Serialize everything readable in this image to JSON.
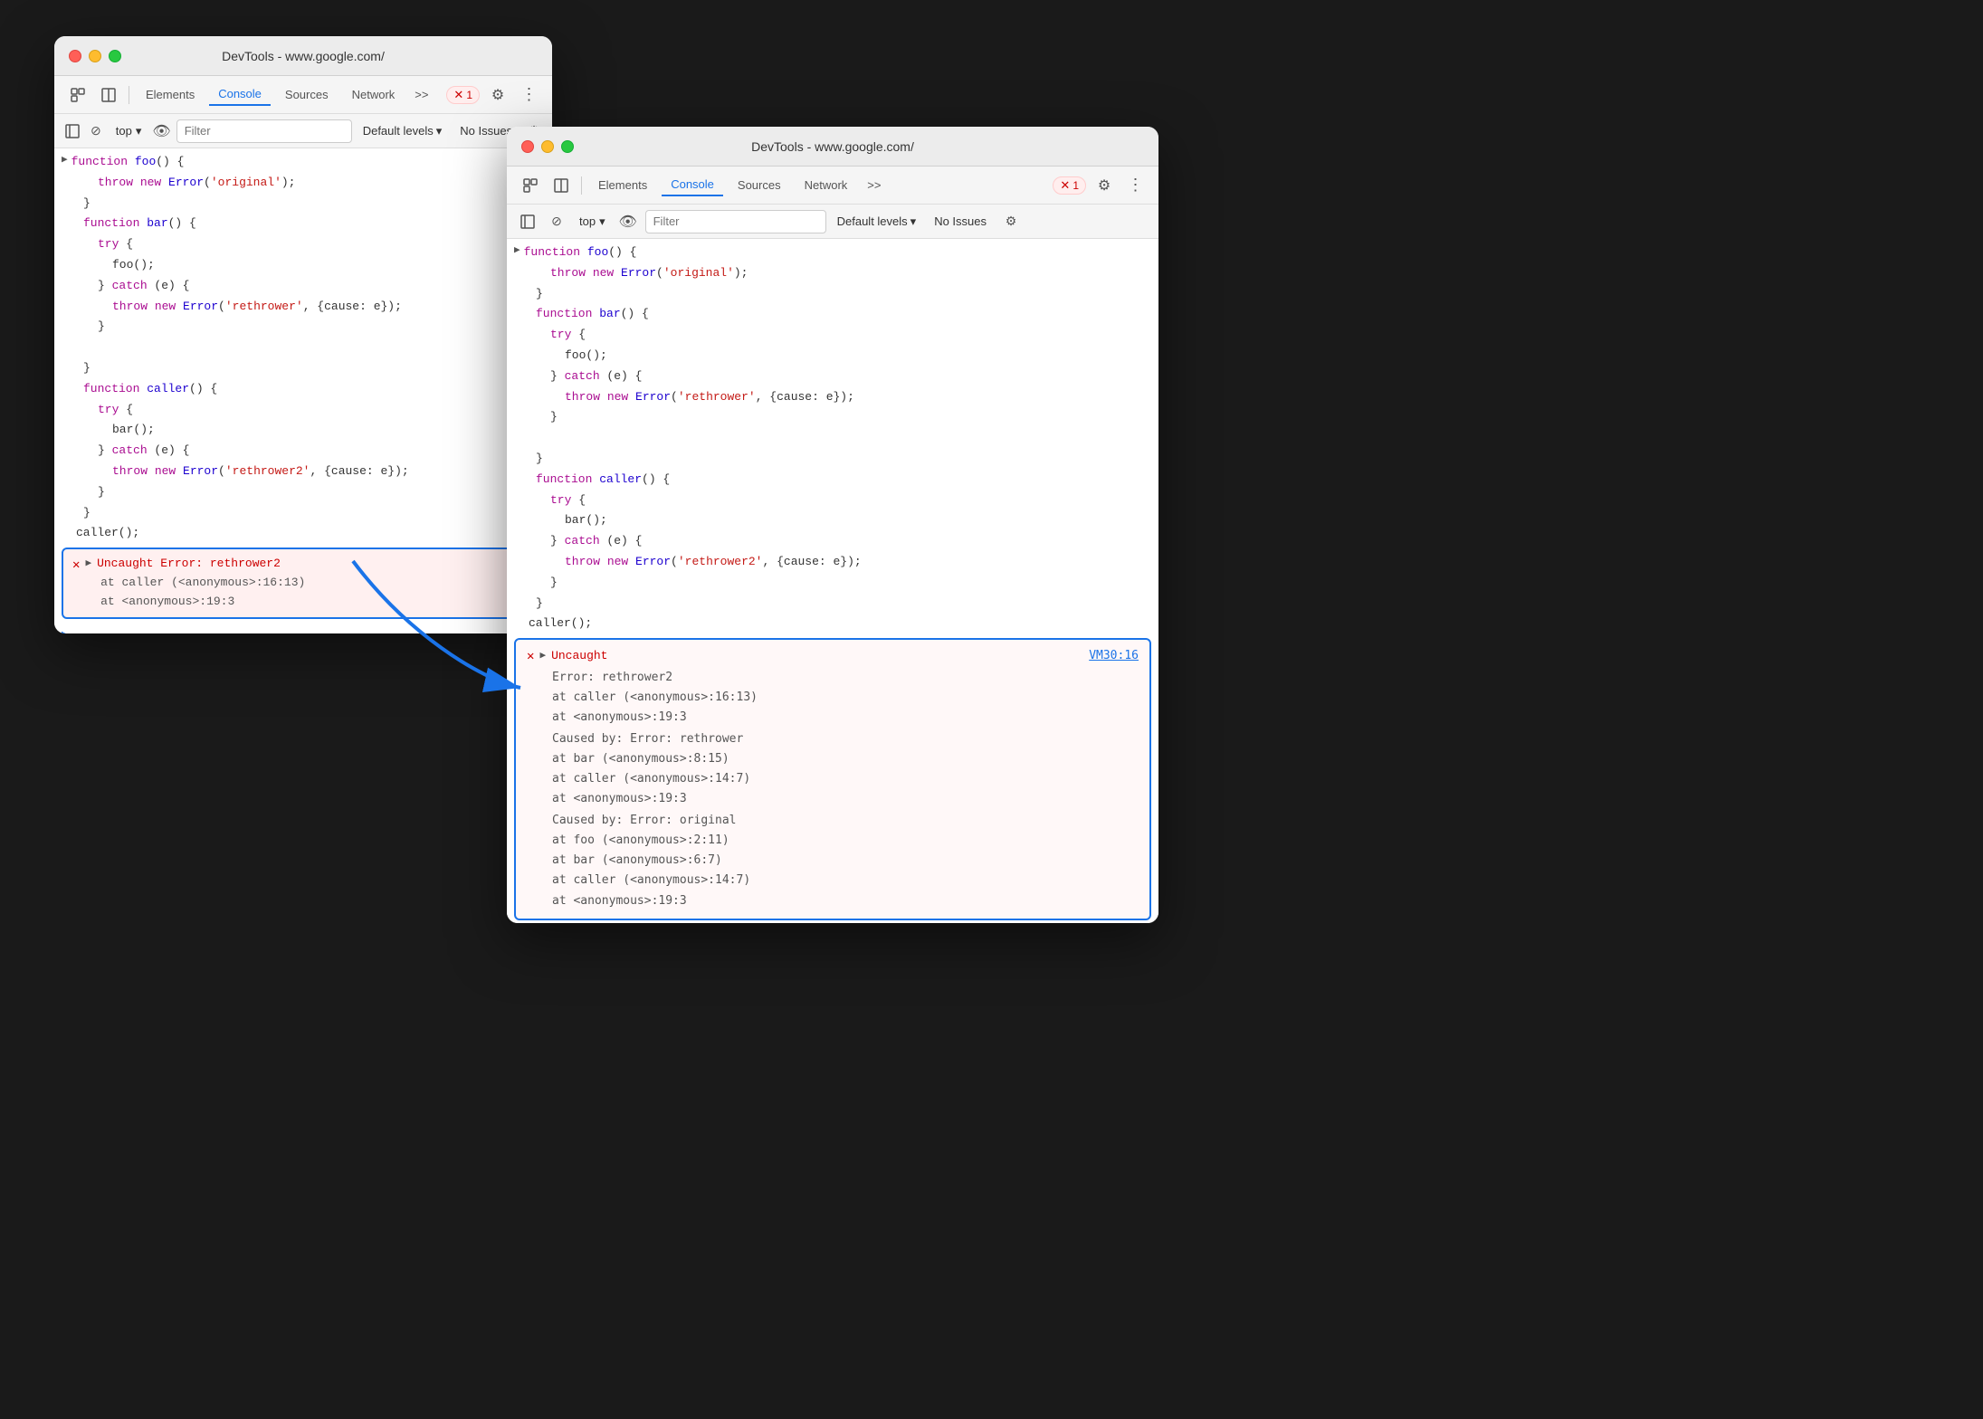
{
  "window1": {
    "title": "DevTools - www.google.com/",
    "tabs": [
      "Elements",
      "Console",
      "Sources",
      "Network",
      ">>"
    ],
    "active_tab": "Console",
    "console_toolbar": {
      "top_label": "top",
      "filter_placeholder": "Filter",
      "levels_label": "Default levels",
      "no_issues": "No Issues"
    },
    "code": [
      {
        "indent": 2,
        "content": "function foo() {"
      },
      {
        "indent": 4,
        "content": "throw new Error('original');"
      },
      {
        "indent": 2,
        "content": "}"
      },
      {
        "indent": 2,
        "content": "function bar() {"
      },
      {
        "indent": 4,
        "content": "try {"
      },
      {
        "indent": 6,
        "content": "foo();"
      },
      {
        "indent": 4,
        "content": "} catch (e) {"
      },
      {
        "indent": 6,
        "content": "throw new Error('rethrower', {cause: e});"
      },
      {
        "indent": 4,
        "content": "}"
      },
      {
        "indent": 2,
        "content": ""
      },
      {
        "indent": 2,
        "content": "}"
      },
      {
        "indent": 2,
        "content": "function caller() {"
      },
      {
        "indent": 4,
        "content": "try {"
      },
      {
        "indent": 6,
        "content": "bar();"
      },
      {
        "indent": 4,
        "content": "} catch (e) {"
      },
      {
        "indent": 6,
        "content": "throw new Error('rethrower2', {cause: e});"
      },
      {
        "indent": 4,
        "content": "}"
      },
      {
        "indent": 2,
        "content": "}"
      },
      {
        "indent": 0,
        "content": "caller();"
      }
    ],
    "error": {
      "main": "Uncaught Error: rethrower2",
      "line1": "at caller (<anonymous>:16:13)",
      "line2": "at <anonymous>:19:3"
    }
  },
  "window2": {
    "title": "DevTools - www.google.com/",
    "tabs": [
      "Elements",
      "Console",
      "Sources",
      "Network",
      ">>"
    ],
    "active_tab": "Console",
    "console_toolbar": {
      "top_label": "top",
      "filter_placeholder": "Filter",
      "levels_label": "Default levels",
      "no_issues": "No Issues"
    },
    "code": [
      {
        "content": "function foo() {"
      },
      {
        "content": "  throw new Error('original');"
      },
      {
        "content": "}"
      },
      {
        "content": "function bar() {"
      },
      {
        "content": "  try {"
      },
      {
        "content": "    foo();"
      },
      {
        "content": "  } catch (e) {"
      },
      {
        "content": "    throw new Error('rethrower', {cause: e});"
      },
      {
        "content": "  }"
      },
      {
        "content": ""
      },
      {
        "content": "}"
      },
      {
        "content": "function caller() {"
      },
      {
        "content": "  try {"
      },
      {
        "content": "    bar();"
      },
      {
        "content": "  } catch (e) {"
      },
      {
        "content": "    throw new Error('rethrower2', {cause: e});"
      },
      {
        "content": "  }"
      },
      {
        "content": "}"
      },
      {
        "content": "caller();"
      }
    ],
    "error": {
      "header": "Uncaught",
      "vm_link": "VM30:16",
      "line0": "Error: rethrower2",
      "line1": "    at caller (<anonymous>:16:13)",
      "line2": "    at <anonymous>:19:3",
      "caused1_header": "Caused by: Error: rethrower",
      "caused1_line1": "    at bar (<anonymous>:8:15)",
      "caused1_line2": "    at caller (<anonymous>:14:7)",
      "caused1_line3": "    at <anonymous>:19:3",
      "caused2_header": "Caused by: Error: original",
      "caused2_line1": "    at foo (<anonymous>:2:11)",
      "caused2_line2": "    at bar (<anonymous>:6:7)",
      "caused2_line3": "    at caller (<anonymous>:14:7)",
      "caused2_line4": "    at <anonymous>:19:3"
    }
  },
  "icons": {
    "error_circle": "⊗",
    "expand": "▶",
    "inspect": "⬚",
    "ban": "⊘",
    "eye": "👁",
    "gear": "⚙",
    "kebab": "⋮",
    "chevron_down": "▾",
    "cursor": "☰",
    "panel": "⊡"
  }
}
